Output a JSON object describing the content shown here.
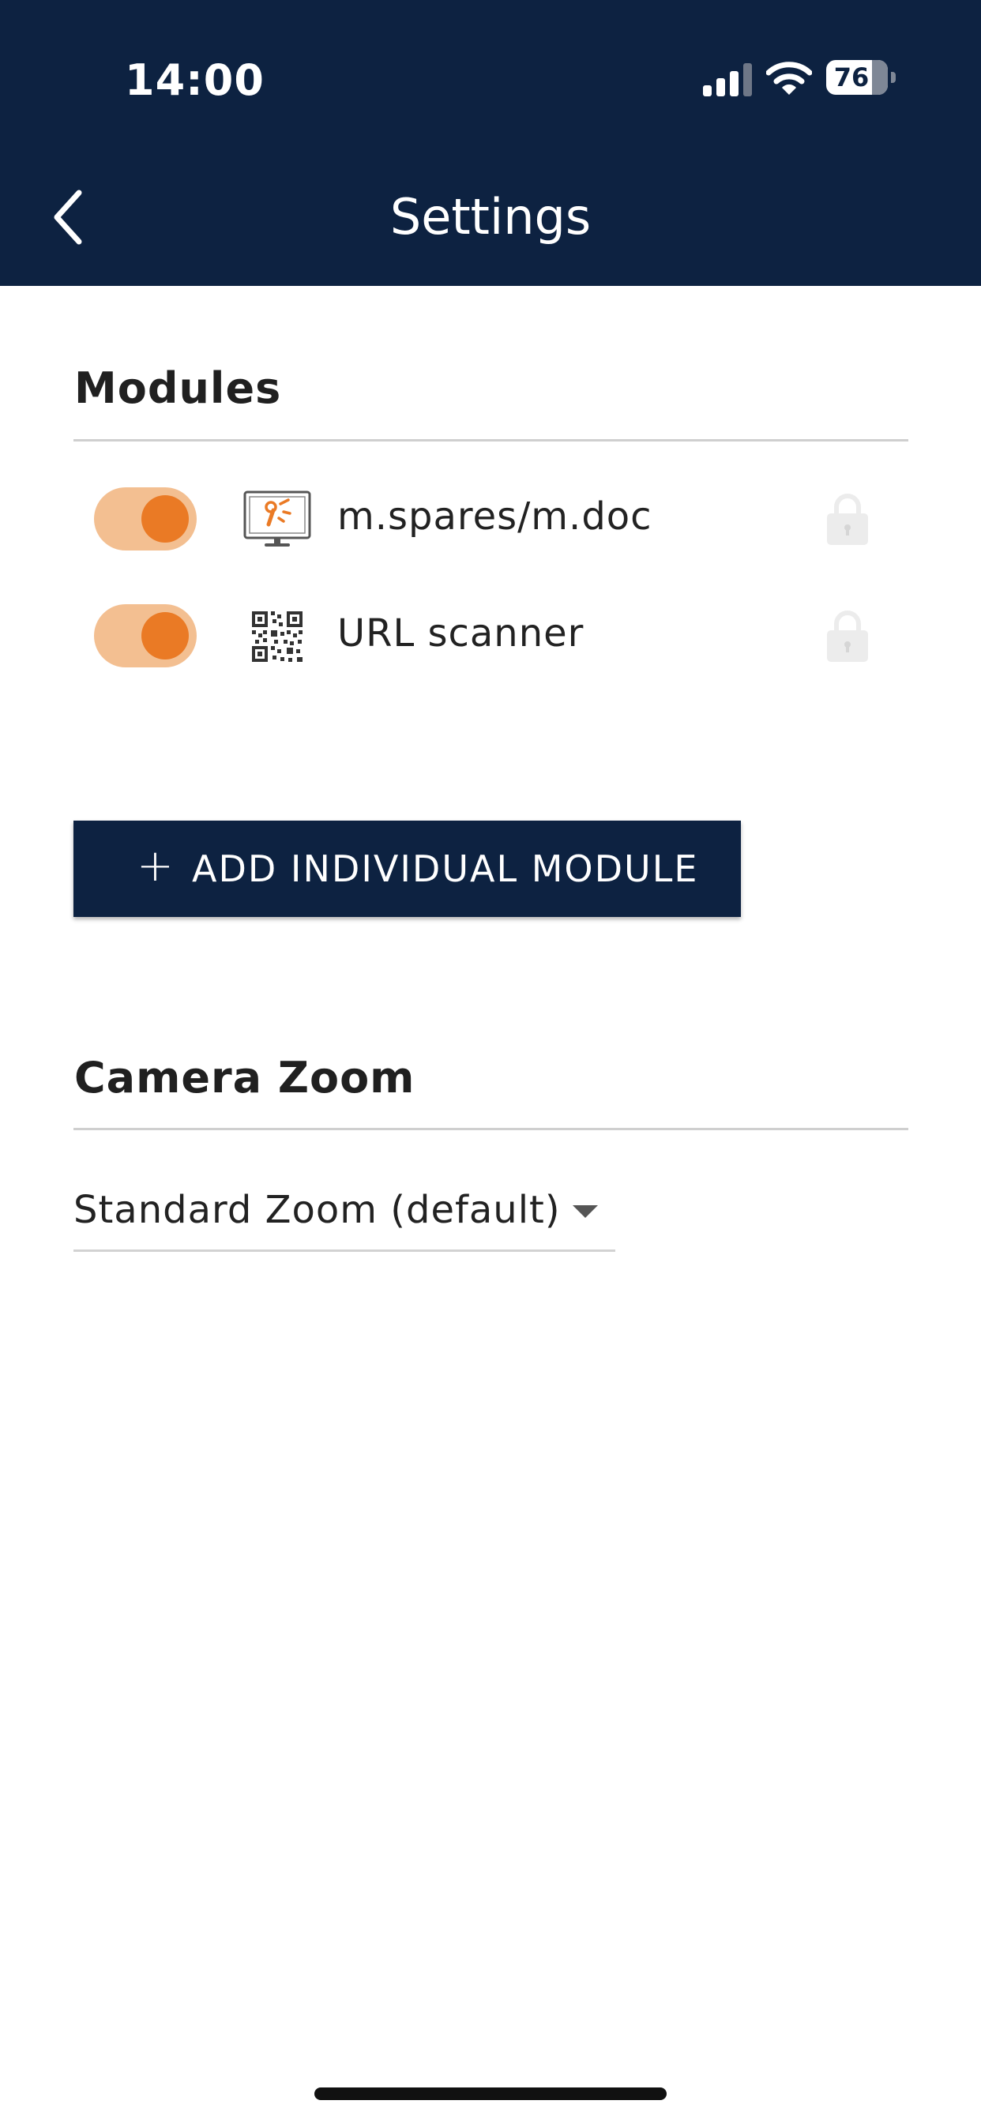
{
  "status_bar": {
    "time": "14:00",
    "battery": "76",
    "signal_icon": "cellular-signal-icon",
    "wifi_icon": "wifi-icon",
    "battery_icon": "battery-icon"
  },
  "header": {
    "title": "Settings",
    "back_icon": "chevron-left-icon",
    "background_color": "#0d2241"
  },
  "modules": {
    "title": "Modules",
    "items": [
      {
        "label": "m.spares/m.doc",
        "enabled": true,
        "icon": "monitor-tools-icon",
        "locked": true
      },
      {
        "label": "URL scanner",
        "enabled": true,
        "icon": "qr-code-icon",
        "locked": true
      }
    ],
    "toggle_track_color": "#f3bf91",
    "toggle_knob_color": "#ea7a25",
    "add_button": {
      "plus": "+",
      "label": "ADD INDIVIDUAL MODULE"
    }
  },
  "camera_zoom": {
    "title": "Camera Zoom",
    "selected": "Standard Zoom (default)"
  }
}
